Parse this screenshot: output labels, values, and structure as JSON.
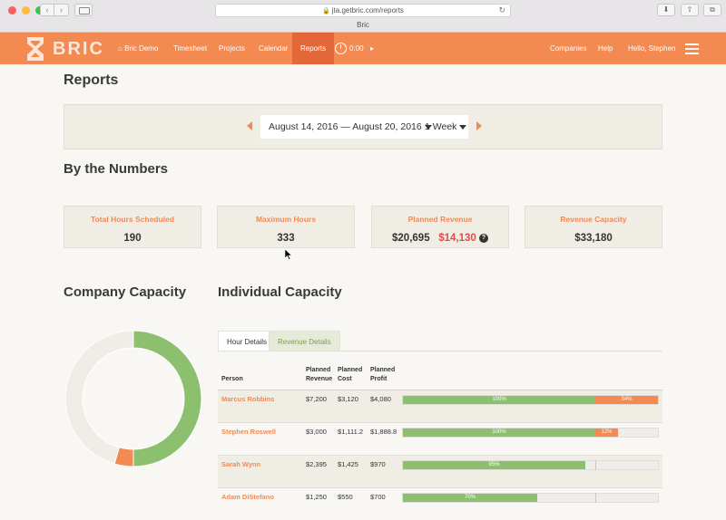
{
  "browser": {
    "url": "jta.getbric.com/reports",
    "tab_title": "Bric"
  },
  "nav": {
    "brand": "BRIC",
    "items": [
      {
        "label": "Bric Demo"
      },
      {
        "label": "Timesheet"
      },
      {
        "label": "Projects"
      },
      {
        "label": "Calendar"
      },
      {
        "label": "Reports"
      }
    ],
    "timer": "0:00",
    "right": [
      {
        "label": "Companies"
      },
      {
        "label": "Help"
      },
      {
        "label": "Hello, Stephen"
      }
    ]
  },
  "page": {
    "title": "Reports",
    "date_range": "August 14, 2016 — August 20, 2016",
    "period": "1 Week",
    "numbers_title": "By the Numbers",
    "cards": [
      {
        "title": "Total Hours Scheduled",
        "value": "190"
      },
      {
        "title": "Maximum Hours",
        "value": "333"
      },
      {
        "title": "Planned Revenue",
        "value": "$20,695",
        "value2": "$14,130"
      },
      {
        "title": "Revenue Capacity",
        "value": "$33,180"
      }
    ],
    "company_capacity_title": "Company Capacity",
    "individual_capacity_title": "Individual Capacity"
  },
  "company_capacity": {
    "segments": [
      {
        "share": 0.5,
        "color": "#8cc06e"
      },
      {
        "share": 0.045,
        "color": "#f28a52"
      },
      {
        "share": 0.455,
        "color": "#efede6"
      }
    ]
  },
  "individual": {
    "tabs": [
      "Hour Details",
      "Revenue Details"
    ],
    "columns": {
      "person": "Person",
      "revenue": [
        "Planned",
        "Revenue"
      ],
      "cost": [
        "Planned",
        "Cost"
      ],
      "profit": [
        "Planned",
        "Profit"
      ]
    },
    "rows": [
      {
        "name": "Marcus Robbins",
        "revenue": "$7,200",
        "cost": "$3,120",
        "profit": "$4,080",
        "pct_label": "100%",
        "pct": 1.0,
        "over_label": "34%",
        "over": 0.34
      },
      {
        "name": "Stephen Roswell",
        "revenue": "$3,000",
        "cost": "$1,111.2",
        "profit": "$1,888.8",
        "pct_label": "100%",
        "pct": 1.0,
        "over_label": "12%",
        "over": 0.12
      },
      {
        "name": "Sarah Wynn",
        "revenue": "$2,395",
        "cost": "$1,425",
        "profit": "$970",
        "pct_label": "95%",
        "pct": 0.95,
        "over_label": "",
        "over": 0
      },
      {
        "name": "Adam DiStefano",
        "revenue": "$1,250",
        "cost": "$550",
        "profit": "$700",
        "pct_label": "70%",
        "pct": 0.7,
        "over_label": "",
        "over": 0
      }
    ]
  }
}
